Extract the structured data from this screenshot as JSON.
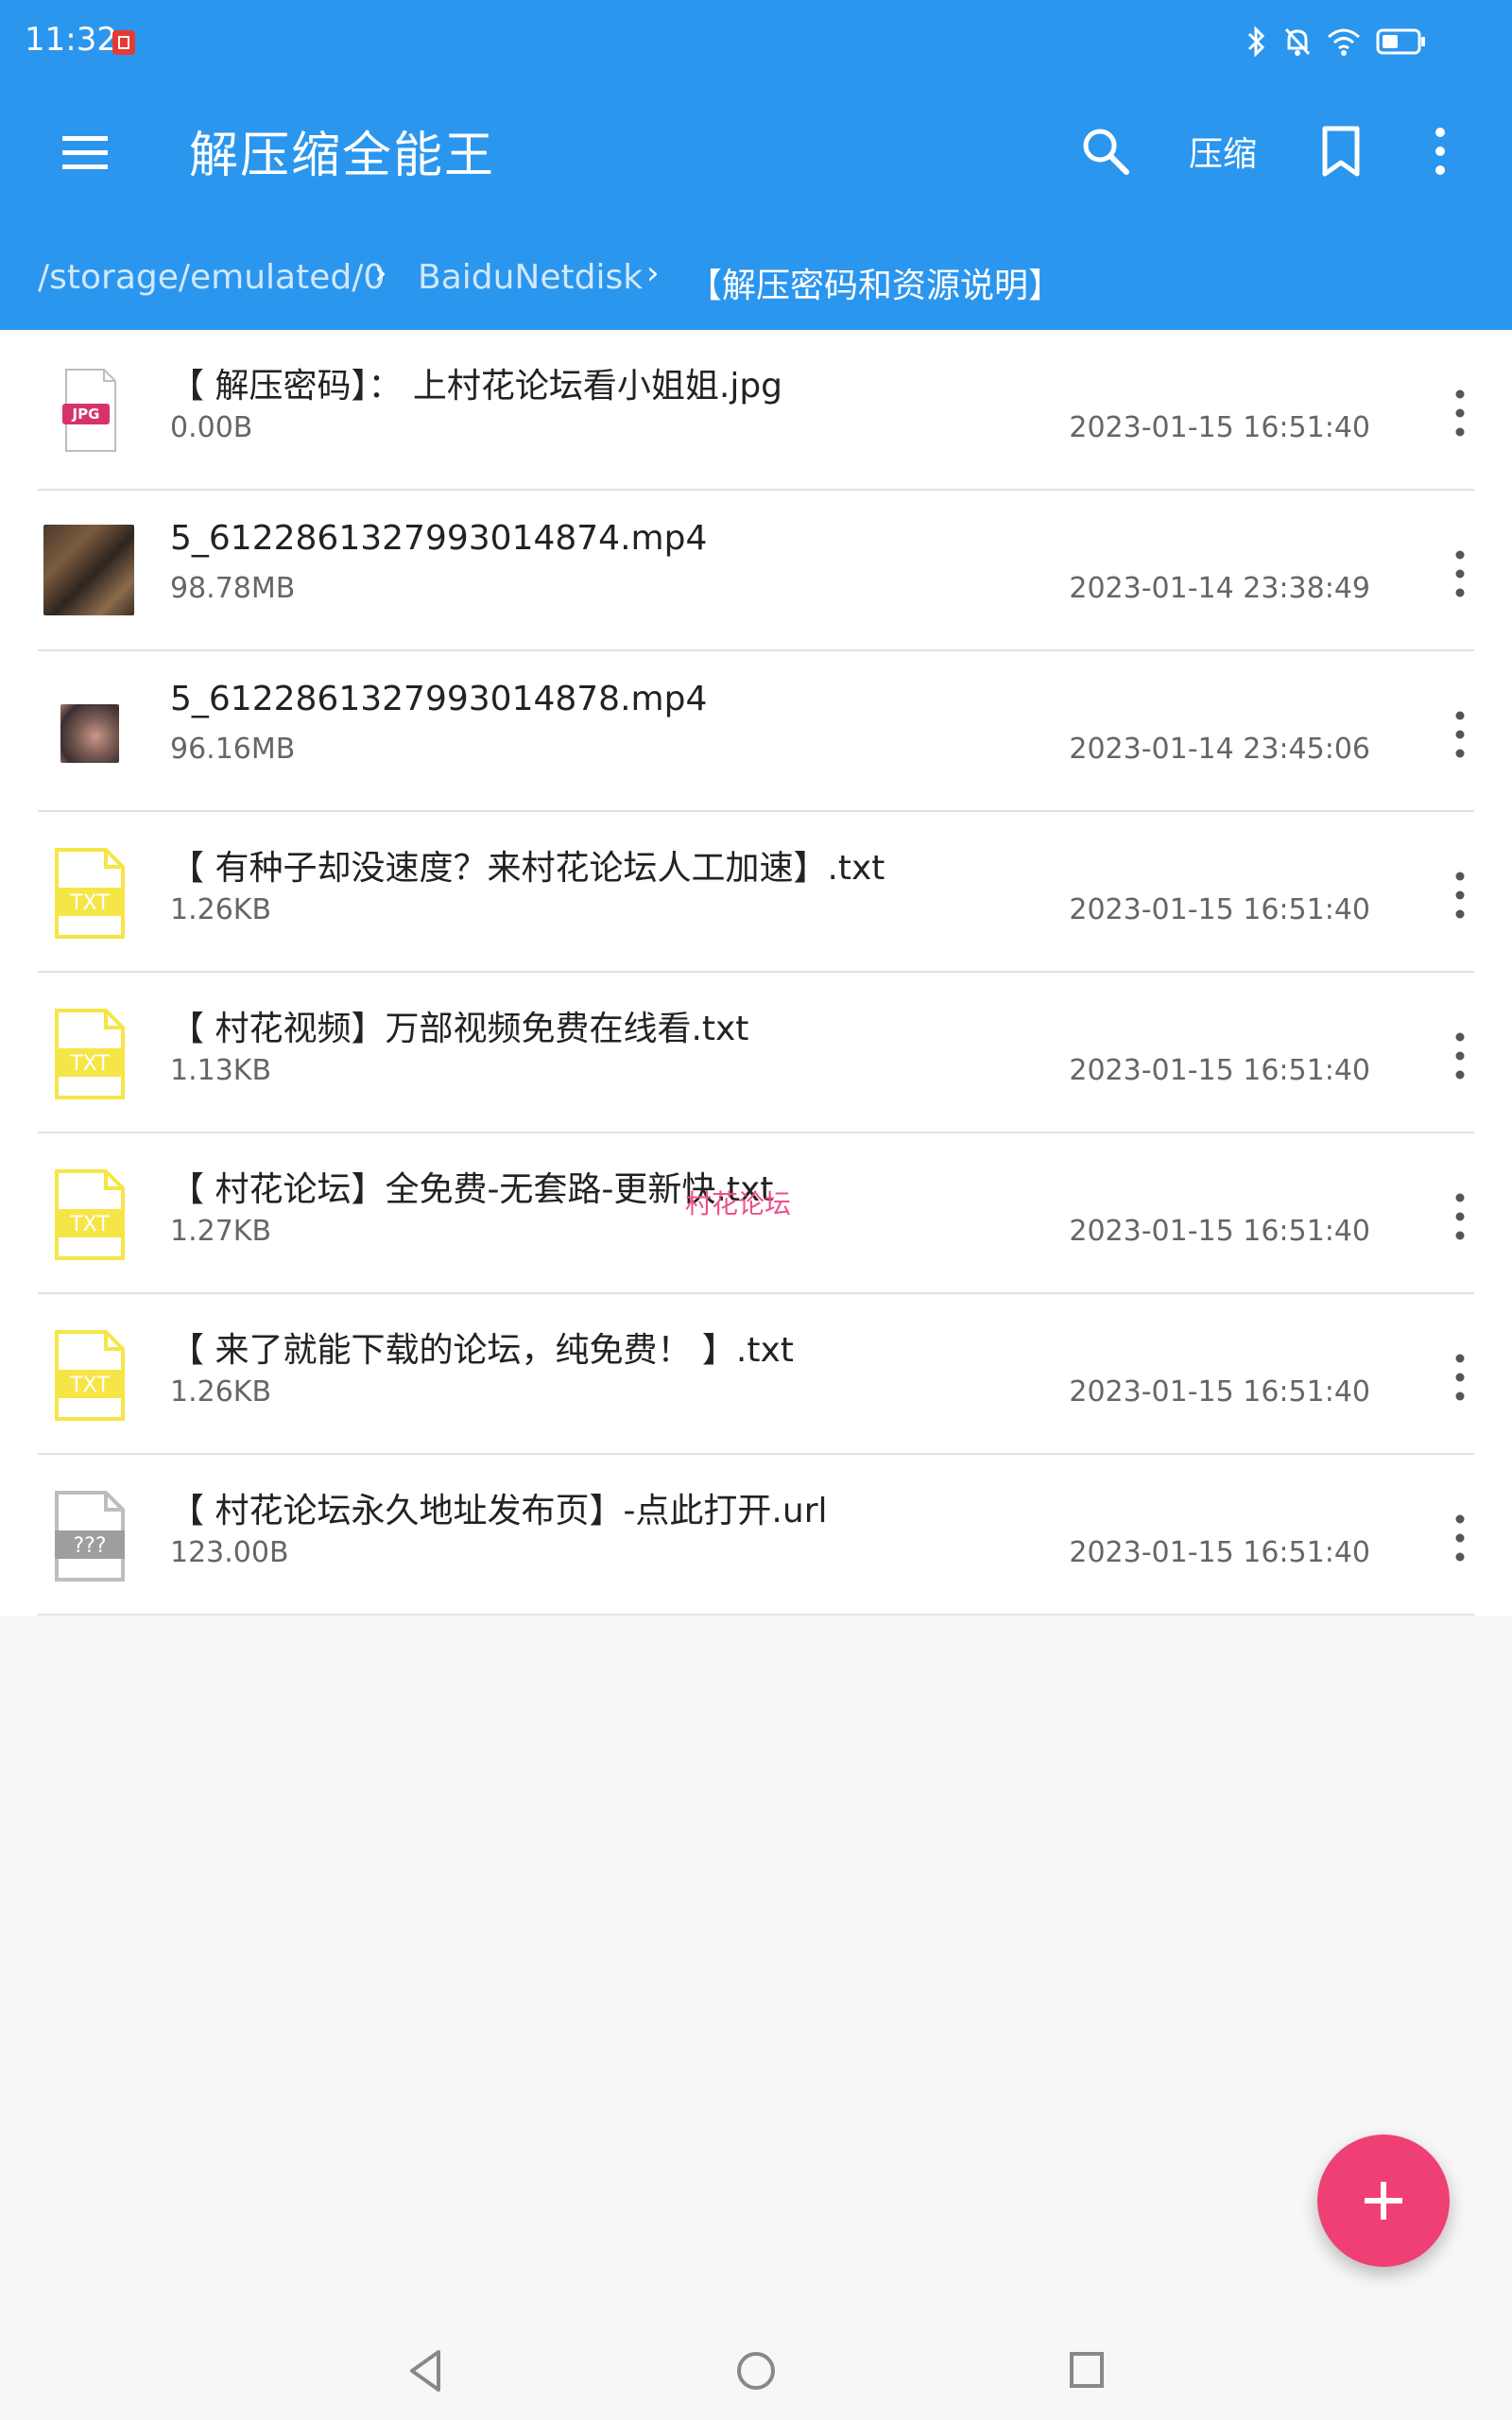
{
  "status_bar": {
    "time": "11:32"
  },
  "toolbar": {
    "title": "解压缩全能王",
    "compress_label": "压缩"
  },
  "breadcrumb": [
    "/storage/emulated/0",
    "BaiduNetdisk",
    "【解压密码和资源说明】"
  ],
  "files": [
    {
      "name": "【 解压密码】： 上村花论坛看小姐姐.jpg",
      "size": "0.00B",
      "date": "2023-01-15 16:51:40",
      "badge": "JPG"
    },
    {
      "name": "5_6122861327993014874.mp4",
      "size": "98.78MB",
      "date": "2023-01-14 23:38:49",
      "badge": ""
    },
    {
      "name": "5_6122861327993014878.mp4",
      "size": "96.16MB",
      "date": "2023-01-14 23:45:06",
      "badge": ""
    },
    {
      "name": "【 有种子却没速度？来村花论坛人工加速】.txt",
      "size": "1.26KB",
      "date": "2023-01-15 16:51:40",
      "badge": "TXT"
    },
    {
      "name": "【 村花视频】万部视频免费在线看.txt",
      "size": "1.13KB",
      "date": "2023-01-15 16:51:40",
      "badge": "TXT"
    },
    {
      "name": "【 村花论坛】全免费-无套路-更新快.txt",
      "size": "1.27KB",
      "date": "2023-01-15 16:51:40",
      "badge": "TXT"
    },
    {
      "name": "【 来了就能下载的论坛，纯免费！ 】.txt",
      "size": "1.26KB",
      "date": "2023-01-15 16:51:40",
      "badge": "TXT"
    },
    {
      "name": "【 村花论坛永久地址发布页】-点此打开.url",
      "size": "123.00B",
      "date": "2023-01-15 16:51:40",
      "badge": "???"
    }
  ],
  "watermark": "村花论坛",
  "colors": {
    "appbar": "#2b96ee",
    "fab": "#f03f75",
    "txt_icon": "#f6e547",
    "jpg_badge": "#d6336c",
    "unknown_icon": "#9e9e9e"
  },
  "icons": [
    "menu-icon",
    "search-icon",
    "bookmark-icon",
    "more-vert-icon",
    "plus-icon",
    "nav-back-icon",
    "nav-home-icon",
    "nav-recent-icon"
  ]
}
